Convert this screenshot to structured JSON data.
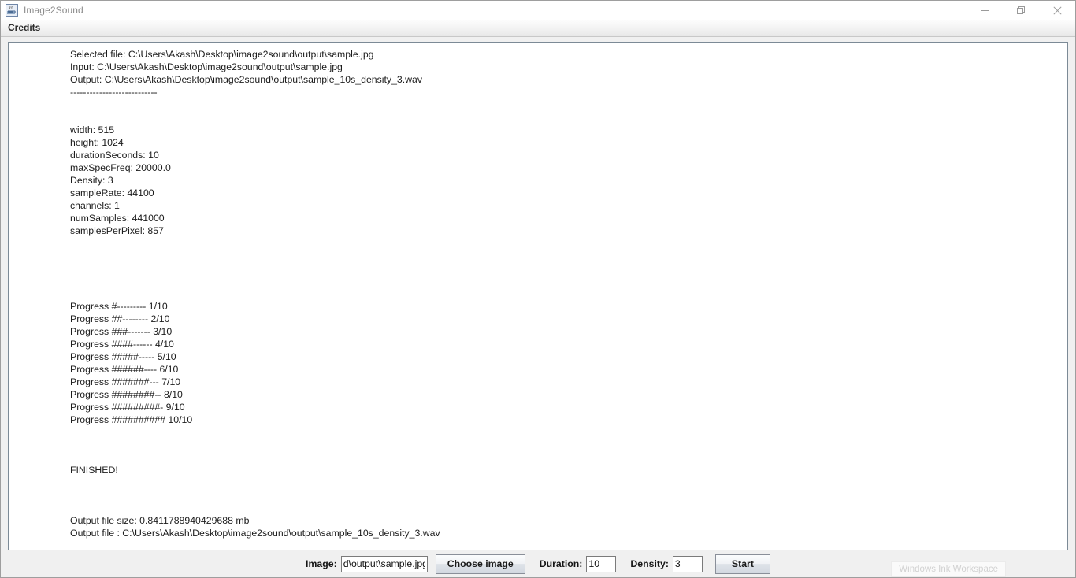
{
  "window": {
    "title": "Image2Sound",
    "app_icon": "java-coffee-cup-icon",
    "controls": {
      "minimize": "minimize-icon",
      "restore": "restore-icon",
      "close": "close-icon"
    }
  },
  "menubar": {
    "items": [
      {
        "label": "Credits",
        "name": "menu-item-credits"
      }
    ]
  },
  "console": {
    "lines": [
      "Selected file: C:\\Users\\Akash\\Desktop\\image2sound\\output\\sample.jpg",
      "Input: C:\\Users\\Akash\\Desktop\\image2sound\\output\\sample.jpg",
      "Output: C:\\Users\\Akash\\Desktop\\image2sound\\output\\sample_10s_density_3.wav",
      "---------------------------",
      "",
      "",
      "width: 515",
      "height: 1024",
      "durationSeconds: 10",
      "maxSpecFreq: 20000.0",
      "Density: 3",
      "sampleRate: 44100",
      "channels: 1",
      "numSamples: 441000",
      "samplesPerPixel: 857",
      "",
      "",
      "",
      "",
      "",
      "Progress #--------- 1/10",
      "Progress ##-------- 2/10",
      "Progress ###------- 3/10",
      "Progress ####------ 4/10",
      "Progress #####----- 5/10",
      "Progress ######---- 6/10",
      "Progress #######--- 7/10",
      "Progress ########-- 8/10",
      "Progress #########- 9/10",
      "Progress ########## 10/10",
      "",
      "",
      "",
      "FINISHED!",
      "",
      "",
      "",
      "Output file size: 0.8411788940429688 mb",
      "Output file : C:\\Users\\Akash\\Desktop\\image2sound\\output\\sample_10s_density_3.wav"
    ]
  },
  "controlbar": {
    "image_label": "Image:",
    "image_value": "d\\output\\sample.jpg",
    "image_placeholder": "",
    "choose_image_label": "Choose image",
    "duration_label": "Duration:",
    "duration_value": "10",
    "density_label": "Density:",
    "density_value": "3",
    "start_label": "Start"
  },
  "overlay": {
    "ink_workspace_label": "Windows Ink Workspace"
  },
  "colors": {
    "panel": "#f0f0f0",
    "console_bg": "#ffffff",
    "console_border": "#7c8a96",
    "text": "#1c1c1c",
    "title_text": "#8a8a8a",
    "close_hover": "#e81123"
  }
}
